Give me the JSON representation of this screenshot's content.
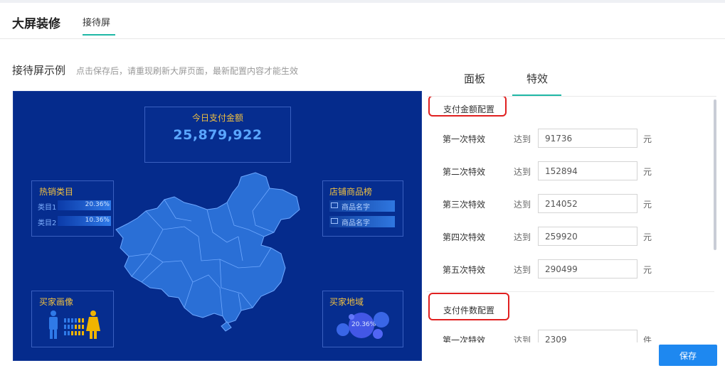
{
  "header": {
    "app_title": "大屏装修",
    "active_tab": "接待屏"
  },
  "section": {
    "title": "接待屏示例",
    "hint": "点击保存后，请重现刷新大屏页面，最新配置内容才能生效"
  },
  "preview": {
    "kpi": {
      "title": "今日支付金额",
      "value": "25,879,922"
    },
    "hot_categories": {
      "title": "热销类目",
      "rows": [
        {
          "label": "类目1",
          "pct": "20.36%"
        },
        {
          "label": "类目2",
          "pct": "10.36%"
        }
      ]
    },
    "shop_rank": {
      "title": "店铺商品榜",
      "rows": [
        {
          "label": "商品名字"
        },
        {
          "label": "商品名字"
        }
      ]
    },
    "buyer_profile": {
      "title": "买家画像"
    },
    "buyer_region": {
      "title": "买家地域",
      "pct": "20.36%"
    }
  },
  "right_tabs": [
    {
      "label": "面板"
    },
    {
      "label": "特效"
    }
  ],
  "effects": {
    "reach_label": "达到",
    "amount_group": {
      "title": "支付金额配置",
      "unit": "元",
      "rows": [
        {
          "name": "第一次特效",
          "value": "91736"
        },
        {
          "name": "第二次特效",
          "value": "152894"
        },
        {
          "name": "第三次特效",
          "value": "214052"
        },
        {
          "name": "第四次特效",
          "value": "259920"
        },
        {
          "name": "第五次特效",
          "value": "290499"
        }
      ]
    },
    "count_group": {
      "title": "支付件数配置",
      "unit": "件",
      "rows": [
        {
          "name": "第一次特效",
          "value": "2309"
        }
      ]
    }
  },
  "save_label": "保存",
  "colors": {
    "accent": "#1fb8a6",
    "primary": "#1e88f0",
    "preview_bg": "#052b8c",
    "highlight": "#e02020"
  }
}
